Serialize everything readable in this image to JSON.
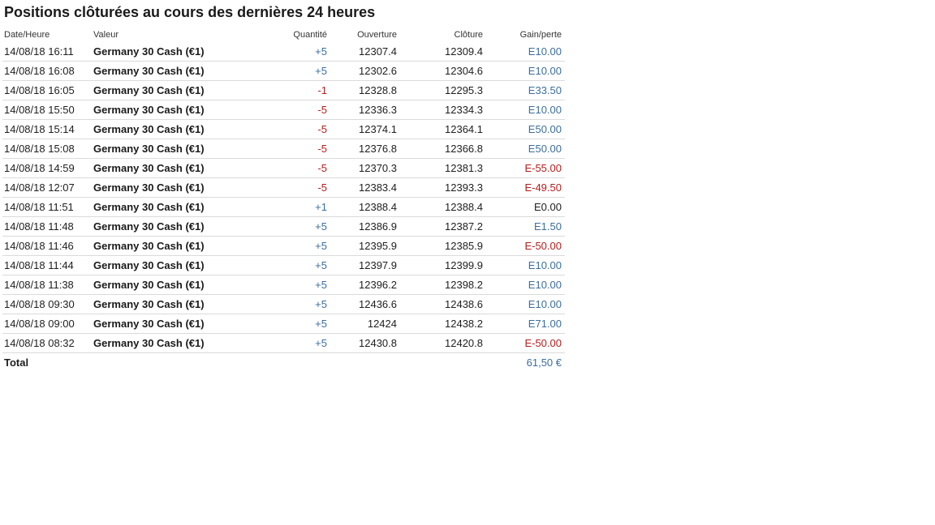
{
  "title": "Positions clôturées au cours des dernières 24 heures",
  "columns": {
    "date": "Date/Heure",
    "valeur": "Valeur",
    "quantite": "Quantité",
    "ouverture": "Ouverture",
    "cloture": "Clôture",
    "gain": "Gain/perte"
  },
  "rows": [
    {
      "date": "14/08/18 16:11",
      "valeur": "Germany 30 Cash (€1)",
      "quantite": "+5",
      "ouverture": "12307.4",
      "cloture": "12309.4",
      "gain": "E10.00"
    },
    {
      "date": "14/08/18 16:08",
      "valeur": "Germany 30 Cash (€1)",
      "quantite": "+5",
      "ouverture": "12302.6",
      "cloture": "12304.6",
      "gain": "E10.00"
    },
    {
      "date": "14/08/18 16:05",
      "valeur": "Germany 30 Cash (€1)",
      "quantite": "-1",
      "ouverture": "12328.8",
      "cloture": "12295.3",
      "gain": "E33.50"
    },
    {
      "date": "14/08/18 15:50",
      "valeur": "Germany 30 Cash (€1)",
      "quantite": "-5",
      "ouverture": "12336.3",
      "cloture": "12334.3",
      "gain": "E10.00"
    },
    {
      "date": "14/08/18 15:14",
      "valeur": "Germany 30 Cash (€1)",
      "quantite": "-5",
      "ouverture": "12374.1",
      "cloture": "12364.1",
      "gain": "E50.00"
    },
    {
      "date": "14/08/18 15:08",
      "valeur": "Germany 30 Cash (€1)",
      "quantite": "-5",
      "ouverture": "12376.8",
      "cloture": "12366.8",
      "gain": "E50.00"
    },
    {
      "date": "14/08/18 14:59",
      "valeur": "Germany 30 Cash (€1)",
      "quantite": "-5",
      "ouverture": "12370.3",
      "cloture": "12381.3",
      "gain": "E-55.00"
    },
    {
      "date": "14/08/18 12:07",
      "valeur": "Germany 30 Cash (€1)",
      "quantite": "-5",
      "ouverture": "12383.4",
      "cloture": "12393.3",
      "gain": "E-49.50"
    },
    {
      "date": "14/08/18 11:51",
      "valeur": "Germany 30 Cash (€1)",
      "quantite": "+1",
      "ouverture": "12388.4",
      "cloture": "12388.4",
      "gain": "E0.00"
    },
    {
      "date": "14/08/18 11:48",
      "valeur": "Germany 30 Cash (€1)",
      "quantite": "+5",
      "ouverture": "12386.9",
      "cloture": "12387.2",
      "gain": "E1.50"
    },
    {
      "date": "14/08/18 11:46",
      "valeur": "Germany 30 Cash (€1)",
      "quantite": "+5",
      "ouverture": "12395.9",
      "cloture": "12385.9",
      "gain": "E-50.00"
    },
    {
      "date": "14/08/18 11:44",
      "valeur": "Germany 30 Cash (€1)",
      "quantite": "+5",
      "ouverture": "12397.9",
      "cloture": "12399.9",
      "gain": "E10.00"
    },
    {
      "date": "14/08/18 11:38",
      "valeur": "Germany 30 Cash (€1)",
      "quantite": "+5",
      "ouverture": "12396.2",
      "cloture": "12398.2",
      "gain": "E10.00"
    },
    {
      "date": "14/08/18 09:30",
      "valeur": "Germany 30 Cash (€1)",
      "quantite": "+5",
      "ouverture": "12436.6",
      "cloture": "12438.6",
      "gain": "E10.00"
    },
    {
      "date": "14/08/18 09:00",
      "valeur": "Germany 30 Cash (€1)",
      "quantite": "+5",
      "ouverture": "12424",
      "cloture": "12438.2",
      "gain": "E71.00"
    },
    {
      "date": "14/08/18 08:32",
      "valeur": "Germany 30 Cash (€1)",
      "quantite": "+5",
      "ouverture": "12430.8",
      "cloture": "12420.8",
      "gain": "E-50.00"
    }
  ],
  "total": {
    "label": "Total",
    "value": "61,50 €"
  },
  "colors": {
    "positive": "#3c6e9e",
    "negative": "#b41e1e",
    "neutral": "#1e1e1e"
  }
}
